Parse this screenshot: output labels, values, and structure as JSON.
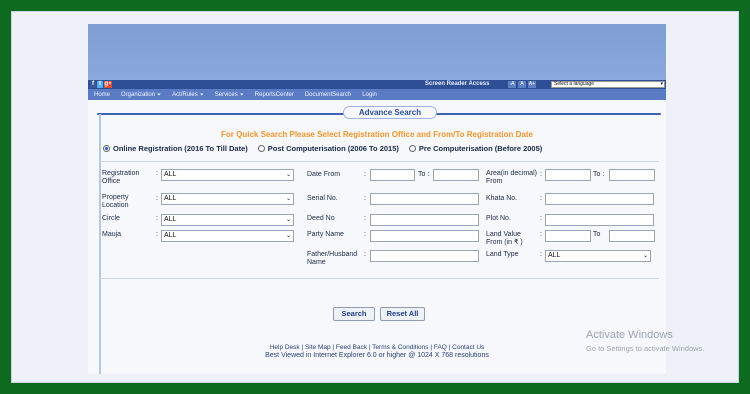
{
  "topbar": {
    "social": [
      "f",
      "t",
      "g+"
    ],
    "screen_reader": "Screen Reader Access",
    "acc": [
      "-A",
      "A",
      "A+"
    ],
    "language": "Select a language"
  },
  "nav": [
    "Home",
    "Organization",
    "Act/Rules",
    "Services",
    "ReportsCenter",
    "DocumentSearch",
    "Login"
  ],
  "title": "Advance Search",
  "quick": "For Quick Search Please Select Registration Office and From/To Registration Date",
  "radios": [
    "Online Registration (2016 To Till Date)",
    "Post Computerisation (2006 To 2015)",
    "Pre Computerisation (Before 2005)"
  ],
  "form": {
    "reg_office": "Registration Office",
    "prop_loc": "Property Location",
    "circle": "Circle",
    "mauja": "Mauja",
    "all": "ALL",
    "date_from": "Date From",
    "to": "To :",
    "serial": "Serial No.",
    "deed": "Deed No",
    "party": "Party Name",
    "father": "Father/Husband Name",
    "area": "Area(in decimal) From",
    "to2": "To :",
    "khata": "Khata No.",
    "plot": "Plot No.",
    "land_value": "Land Value From (in ₹ )",
    "to3": "To",
    "land_type": "Land Type"
  },
  "buttons": {
    "search": "Search",
    "reset": "Reset All"
  },
  "footer": {
    "links": "Help Desk  |  Site Map  |  Feed Back  |  Terms & Conditions  |  FAQ  |  Contact Us",
    "browser": "Best Viewed in Internet Explorer 6.0 or higher @ 1024 X 768 resolutions"
  },
  "watermark": {
    "title": "Activate Windows",
    "sub": "Go to Settings to activate Windows."
  }
}
